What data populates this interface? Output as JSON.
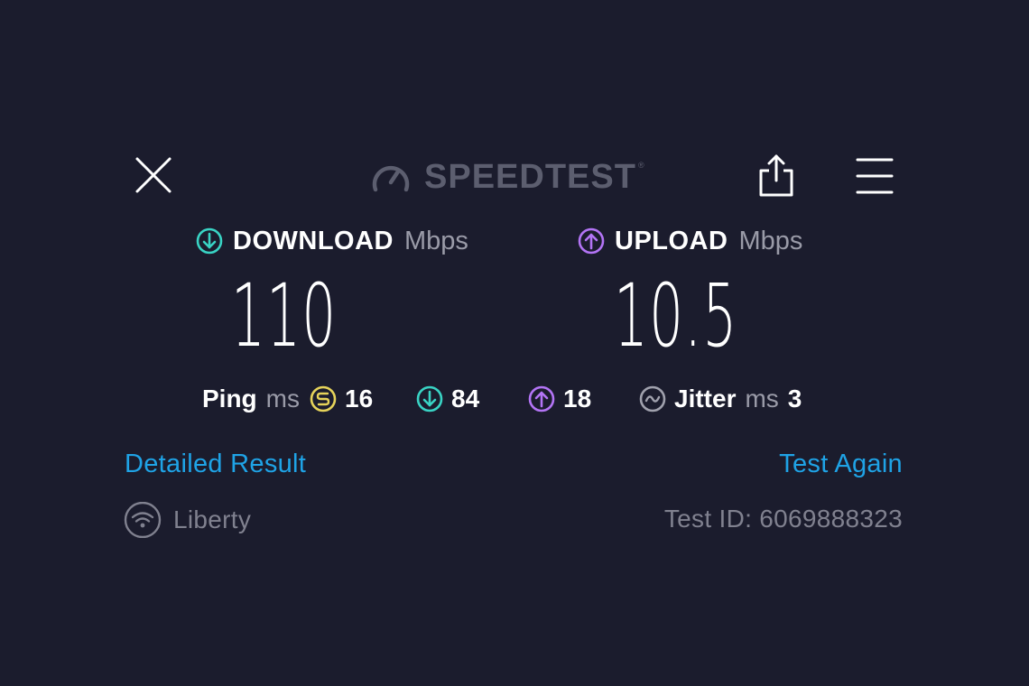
{
  "header": {
    "logo_text": "SPEEDTEST",
    "logo_tm": "®",
    "icons": {
      "close": "close-icon",
      "logo": "speedometer-icon",
      "share": "share-icon",
      "menu": "hamburger-menu-icon"
    }
  },
  "download": {
    "label": "DOWNLOAD",
    "unit": "Mbps",
    "value": "110",
    "icon": "download-arrow-icon",
    "color": "#39d3c4"
  },
  "upload": {
    "label": "UPLOAD",
    "unit": "Mbps",
    "value": "10.5",
    "icon": "upload-arrow-icon",
    "color": "#b374f5"
  },
  "ping": {
    "label": "Ping",
    "unit": "ms",
    "idle_value": "16",
    "idle_color": "#e6d35a",
    "download_value": "84",
    "upload_value": "18"
  },
  "jitter": {
    "label": "Jitter",
    "unit": "ms",
    "value": "3",
    "color": "#a0a1ad"
  },
  "links": {
    "detailed_result": "Detailed Result",
    "test_again": "Test Again",
    "color": "#1fa3e6"
  },
  "footer": {
    "provider": "Liberty",
    "provider_icon": "wifi-icon",
    "test_id": "Test ID: 6069888323"
  }
}
